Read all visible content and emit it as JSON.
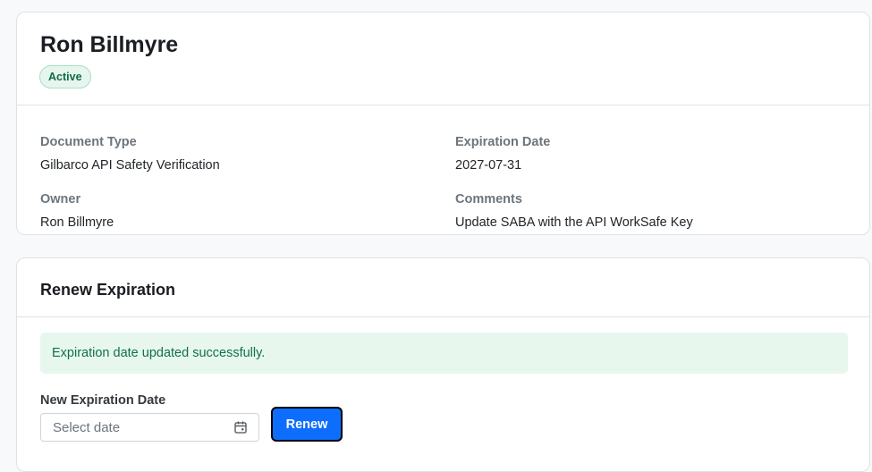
{
  "record": {
    "name": "Ron Billmyre",
    "status": "Active",
    "fields": {
      "document_type": {
        "label": "Document Type",
        "value": "Gilbarco API Safety Verification"
      },
      "expiration_date": {
        "label": "Expiration Date",
        "value": "2027-07-31"
      },
      "owner": {
        "label": "Owner",
        "value": "Ron Billmyre"
      },
      "comments": {
        "label": "Comments",
        "value": "Update SABA with the API WorkSafe Key"
      }
    }
  },
  "renew": {
    "title": "Renew Expiration",
    "success_message": "Expiration date updated successfully.",
    "date_label": "New Expiration Date",
    "date_value": "",
    "date_placeholder": "Select date",
    "date_icon": "calendar-icon",
    "button_label": "Renew"
  },
  "colors": {
    "status_badge_bg": "#e6f6ee",
    "status_badge_text": "#0f6b45",
    "success_alert_bg": "#e7f7ee",
    "success_alert_text": "#127046",
    "primary_button": "#0d6efd"
  }
}
